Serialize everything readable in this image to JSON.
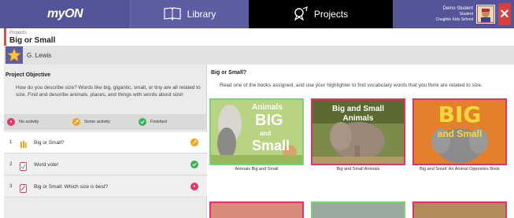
{
  "topbar": {
    "logo": "myON",
    "nav": [
      {
        "label": "Library",
        "icon": "book-icon"
      },
      {
        "label": "Projects",
        "icon": "projects-icon"
      }
    ],
    "user": {
      "name": "Demo Student",
      "role": "Student",
      "school": "Coughlin Kids School"
    },
    "colors": {
      "bar": "#54549a",
      "active_tab": "#000000",
      "close": "#d5403a"
    }
  },
  "breadcrumb": {
    "parent": "Projects",
    "title": "Big or Small"
  },
  "student": {
    "name": "G. Lewis",
    "icon": "star-icon"
  },
  "objective": {
    "heading": "Project Objective",
    "text": "How do you describe size? Words like big, gigantic, small, or tiny are all related to size. Find and describe animals, places, and things with words about size!"
  },
  "legend": [
    {
      "label": "No activity",
      "status": "none",
      "color": "#e33a67"
    },
    {
      "label": "Some activity",
      "status": "some",
      "color": "#f2a21d"
    },
    {
      "label": "Finished",
      "status": "finished",
      "color": "#38b552"
    }
  ],
  "activities": [
    {
      "num": "1",
      "label": "Big or Small?",
      "icon": "highlighter-icon",
      "status": "some"
    },
    {
      "num": "2",
      "label": "Word vote!",
      "icon": "vote-icon",
      "status": "finished"
    },
    {
      "num": "3",
      "label": "Big or Small: Which size is best?",
      "icon": "writing-icon",
      "status": "none"
    }
  ],
  "assignment": {
    "title": "Big or Small?",
    "instructions": "Read one of the books assigned, and use your highlighter to find vocabulary words that you think are related to size."
  },
  "books": [
    {
      "caption": "Animals Big and Small",
      "cover_text_1": "Animals",
      "cover_text_2": "BIG",
      "cover_text_3": "and",
      "cover_text_4": "Small",
      "border": "#7fcf7a"
    },
    {
      "caption": "Big and Small Animals",
      "cover_text_1": "Big and Small",
      "cover_text_2": "Animals",
      "border": "#e0336b"
    },
    {
      "caption": "Big and Small: An Animal Opposites Book",
      "cover_text_1": "BIG",
      "cover_text_2": "and Small",
      "border": "#e0336b"
    }
  ]
}
